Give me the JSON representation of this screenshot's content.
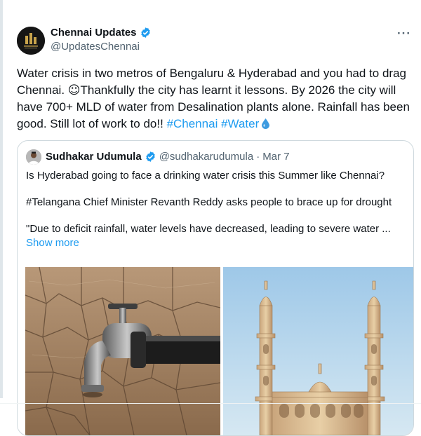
{
  "tweet": {
    "author_name": "Chennai Updates",
    "author_handle": "@UpdatesChennai",
    "more_label": "···",
    "text_part1": "Water crisis in two metros of Bengaluru & Hyderabad and you had to drag Chennai. ",
    "emoji": "☺",
    "text_part2": "Thankfully the city has learnt it lessons. By 2026 the city will have 700+ MLD of water from Desalination plants alone. Rainfall has been good. Still lot of work to do!! ",
    "hashtags": [
      "#Chennai",
      "#Water"
    ],
    "verified_color": "#1d9bf0",
    "accent_color": "#1d9bf0"
  },
  "quote": {
    "author_name": "Sudhakar Udumula",
    "author_handle": "@sudhakarudumula",
    "separator": "·",
    "date": "Mar 7",
    "line1": "Is Hyderabad going to face a drinking water crisis this Summer like Chennai?",
    "line2": "#Telangana Chief Minister Revanth Reddy asks people to brace up for drought",
    "line3": "\"Due to deficit rainfall, water levels have decreased, leading to severe water ...",
    "show_more": "Show more",
    "verified_color": "#1d9bf0"
  },
  "media": {
    "left_icon": "dry-soil-water-tap-icon",
    "right_icon": "charminar-monument-icon"
  }
}
